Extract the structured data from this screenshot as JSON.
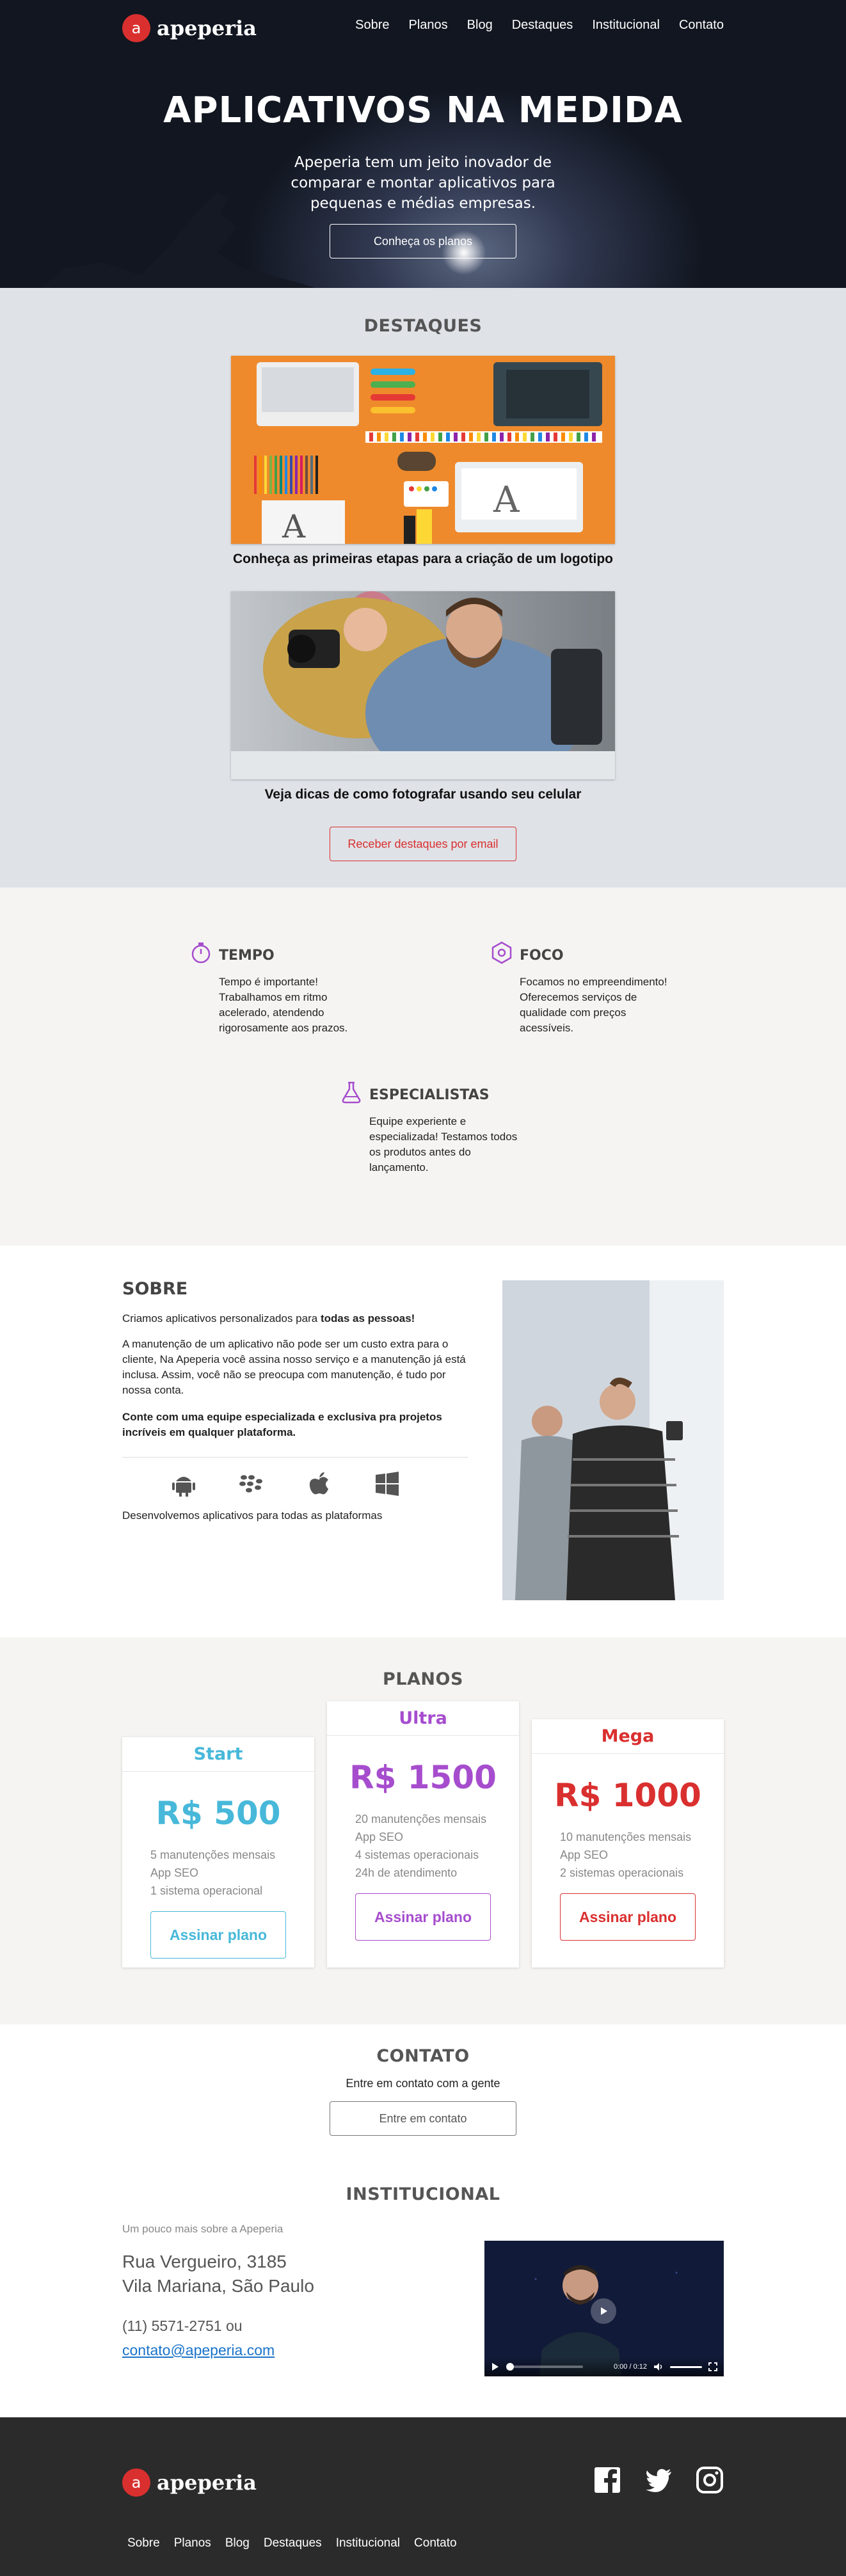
{
  "brand": {
    "name": "apeperia",
    "accent": "#d9302f"
  },
  "nav": {
    "items": [
      "Sobre",
      "Planos",
      "Blog",
      "Destaques",
      "Institucional",
      "Contato"
    ]
  },
  "hero": {
    "title": "APLICATIVOS NA MEDIDA",
    "subtitle": "Apeperia tem um jeito inovador de comparar e montar aplicativos para pequenas e médias empresas.",
    "button": "Conheça os planos"
  },
  "destaques": {
    "title": "DESTAQUES",
    "items": [
      {
        "caption": "Conheça as primeiras etapas para a criação de um logotipo"
      },
      {
        "caption": "Veja dicas de como fotografar usando seu celular"
      }
    ],
    "button": "Receber destaques por email"
  },
  "features": [
    {
      "title": "TEMPO",
      "text": "Tempo é importante! Trabalhamos em ritmo acelerado, atendendo rigorosamente aos prazos.",
      "icon": "stopwatch-icon"
    },
    {
      "title": "FOCO",
      "text": "Focamos no empreendimento! Oferecemos serviços de qualidade com preços acessíveis.",
      "icon": "target-icon"
    },
    {
      "title": "ESPECIALISTAS",
      "text": "Equipe experiente e especializada! Testamos todos os produtos antes do lançamento.",
      "icon": "flask-icon"
    }
  ],
  "sobre": {
    "title": "SOBRE",
    "p1_plain": "Criamos aplicativos personalizados para ",
    "p1_bold": "todas as pessoas!",
    "p2": "A manutenção de um aplicativo não pode ser um custo extra para o cliente, Na Apeperia você assina nosso serviço e a manutenção já está inclusa. Assim, você não se preocupa com manutenção, é tudo por nossa conta.",
    "p3": "Conte com uma equipe especializada e exclusiva pra projetos incríveis em qualquer plataforma.",
    "platforms": [
      "android-icon",
      "blackberry-icon",
      "apple-icon",
      "windows-icon"
    ],
    "platforms_caption": "Desenvolvemos aplicativos para todas as plataformas"
  },
  "planos": {
    "title": "PLANOS",
    "plans": [
      {
        "name": "Start",
        "price": "R$ 500",
        "color": "#47b8d9",
        "features": [
          "5 manutenções mensais",
          "App SEO",
          "1 sistema operacional"
        ],
        "button": "Assinar plano"
      },
      {
        "name": "Ultra",
        "price": "R$ 1500",
        "color": "#a64dce",
        "features": [
          "20 manutenções mensais",
          "App SEO",
          "4 sistemas operacionais",
          "24h de atendimento"
        ],
        "button": "Assinar plano"
      },
      {
        "name": "Mega",
        "price": "R$ 1000",
        "color": "#d9302f",
        "features": [
          "10 manutenções mensais",
          "App SEO",
          "2 sistemas operacionais"
        ],
        "button": "Assinar plano"
      }
    ]
  },
  "contato": {
    "title": "CONTATO",
    "text": "Entre em contato com a gente",
    "button": "Entre em contato"
  },
  "institucional": {
    "title": "INSTITUCIONAL",
    "lead": "Um pouco mais sobre a Apeperia",
    "address_line1": "Rua Vergueiro, 3185",
    "address_line2": "Vila Mariana, São Paulo",
    "phone": "(11) 5571-2751 ou",
    "email": "contato@apeperia.com",
    "video_time": "0:00 / 0:12"
  },
  "footer": {
    "social": [
      "facebook-icon",
      "twitter-icon",
      "instagram-icon"
    ],
    "links": [
      "Sobre",
      "Planos",
      "Blog",
      "Destaques",
      "Institucional",
      "Contato"
    ]
  }
}
